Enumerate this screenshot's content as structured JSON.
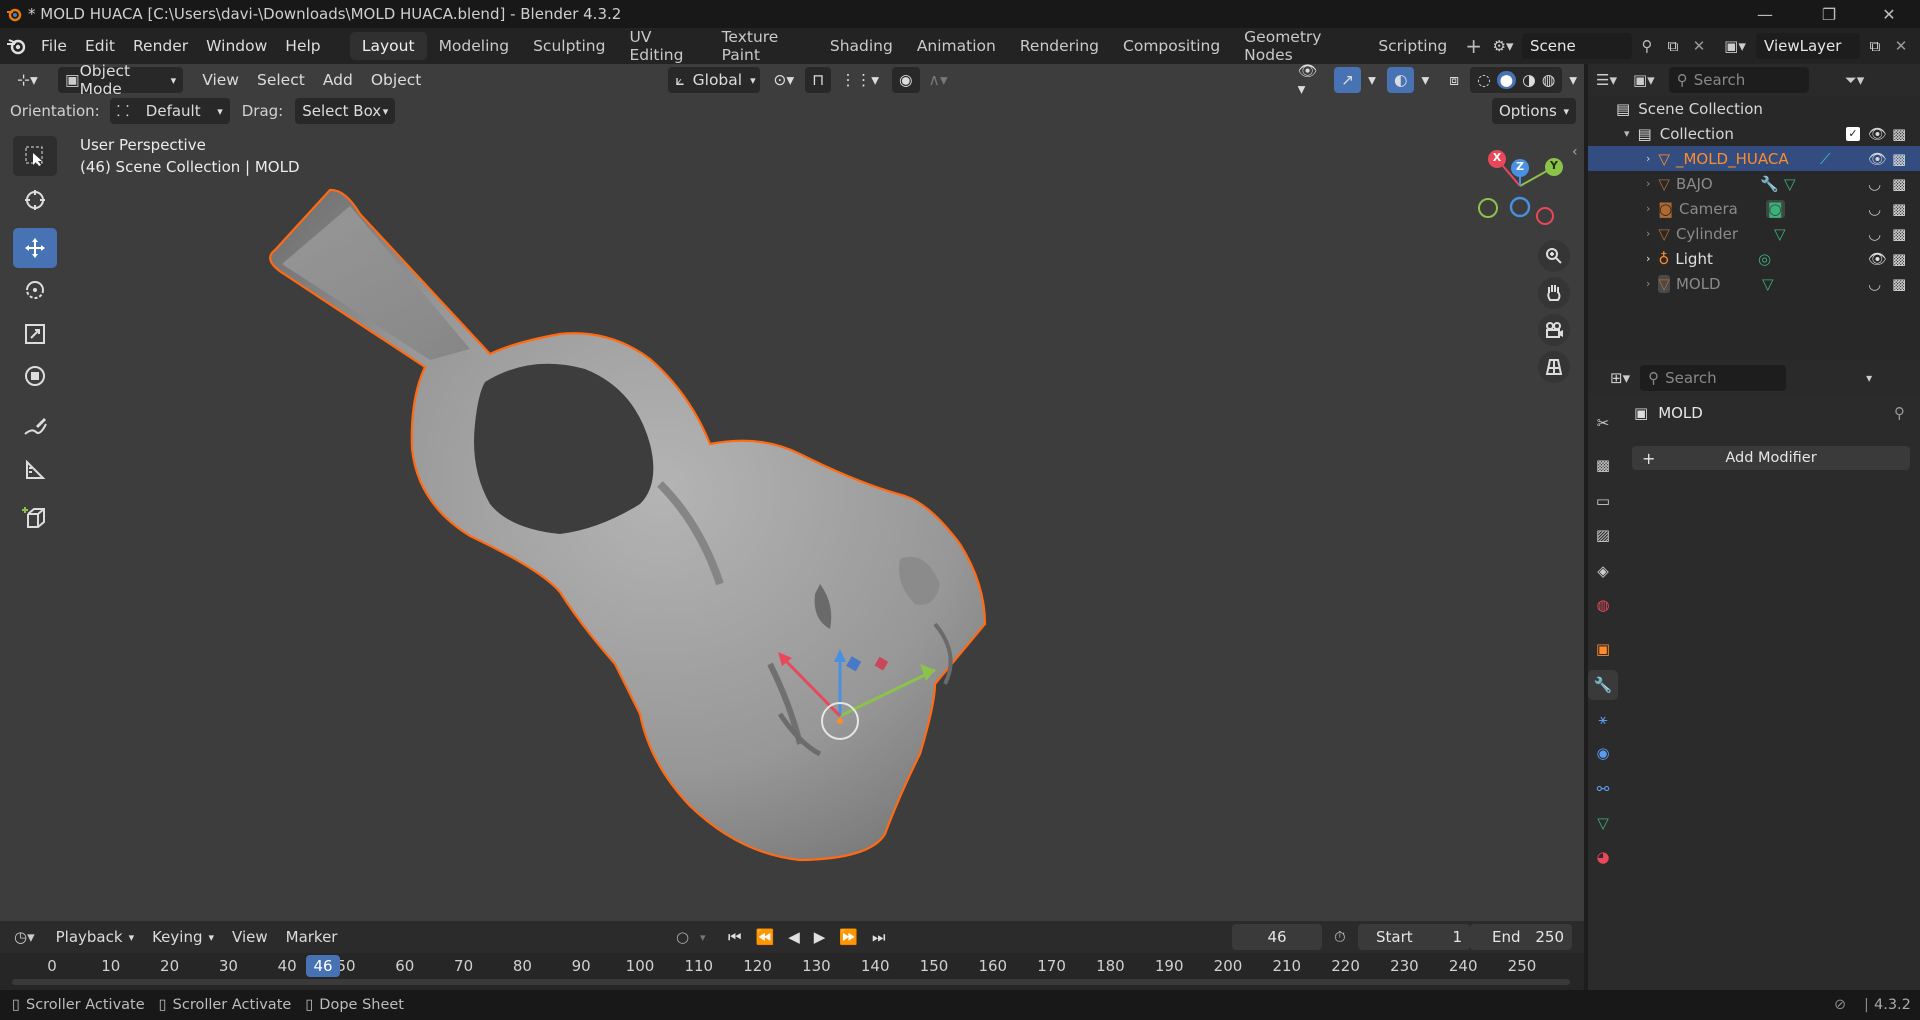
{
  "window": {
    "title": "* MOLD HUACA [C:\\Users\\davi-\\Downloads\\MOLD HUACA.blend] - Blender 4.3.2"
  },
  "menu": {
    "items": [
      "File",
      "Edit",
      "Render",
      "Window",
      "Help"
    ]
  },
  "workspaces": {
    "tabs": [
      "Layout",
      "Modeling",
      "Sculpting",
      "UV Editing",
      "Texture Paint",
      "Shading",
      "Animation",
      "Rendering",
      "Compositing",
      "Geometry Nodes",
      "Scripting"
    ],
    "active": "Layout"
  },
  "scene": {
    "name": "Scene",
    "view_layer": "ViewLayer"
  },
  "viewport": {
    "mode": "Object Mode",
    "menus": [
      "View",
      "Select",
      "Add",
      "Object"
    ],
    "transform_orientation": "Global",
    "orientation_label": "Orientation:",
    "orientation_value": "Default",
    "drag_label": "Drag:",
    "drag_value": "Select Box",
    "options_label": "Options",
    "overlay_line1": "User Perspective",
    "overlay_line2": "(46) Scene Collection | MOLD",
    "gizmo": {
      "x": "X",
      "y": "Y",
      "z": "Z"
    }
  },
  "outliner": {
    "search_placeholder": "Search",
    "root": "Scene Collection",
    "collection": "Collection",
    "objects": [
      {
        "name": "_MOLD_HUACA",
        "selected": true,
        "visible": true
      },
      {
        "name": "BAJO",
        "selected": false,
        "visible": false
      },
      {
        "name": "Camera",
        "selected": false,
        "visible": false
      },
      {
        "name": "Cylinder",
        "selected": false,
        "visible": false
      },
      {
        "name": "Light",
        "selected": false,
        "visible": true
      },
      {
        "name": "MOLD",
        "selected": false,
        "visible": false
      }
    ]
  },
  "properties": {
    "search_placeholder": "Search",
    "object_name": "MOLD",
    "add_modifier": "Add Modifier"
  },
  "timeline": {
    "menus": [
      "Playback",
      "Keying",
      "View",
      "Marker"
    ],
    "current_frame": "46",
    "start_label": "Start",
    "start": "1",
    "end_label": "End",
    "end": "250",
    "ticks": [
      "0",
      "10",
      "20",
      "30",
      "40",
      "50",
      "60",
      "70",
      "80",
      "90",
      "100",
      "110",
      "120",
      "130",
      "140",
      "150",
      "160",
      "170",
      "180",
      "190",
      "200",
      "210",
      "220",
      "230",
      "240",
      "250"
    ]
  },
  "statusbar": {
    "items": [
      "Scroller Activate",
      "Scroller Activate",
      "Dope Sheet"
    ],
    "version": "4.3.2"
  },
  "colors": {
    "accent": "#4772b3",
    "selection_outline": "#ff6a13",
    "active_text": "#ff8c2a"
  }
}
